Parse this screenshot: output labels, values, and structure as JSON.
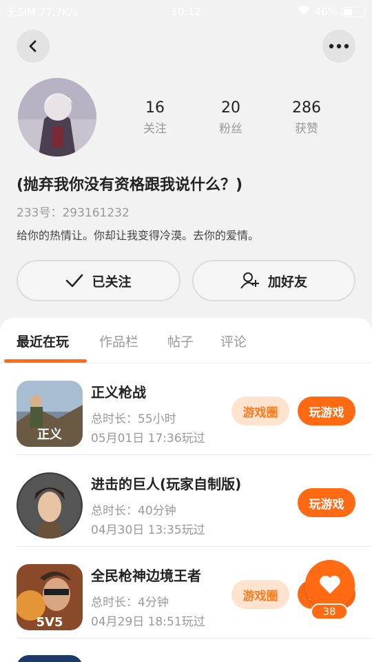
{
  "status_bar": {
    "carrier": "无SIM 77.7K/s",
    "time": "10:12",
    "battery": "46%"
  },
  "profile": {
    "following_count": "16",
    "following_label": "关注",
    "fans_count": "20",
    "fans_label": "粉丝",
    "likes_count": "286",
    "likes_label": "获赞",
    "nickname": "(抛弃我你没有资格跟我说什么？)",
    "uid_label": "233号：",
    "uid_value": "293161232",
    "bio": "给你的热情让。你却让我变得冷漠。去你的爱情。"
  },
  "actions": {
    "followed_label": "已关注",
    "add_friend_label": "加好友"
  },
  "tabs": [
    "最近在玩",
    "作品栏",
    "帖子",
    "评论"
  ],
  "games": [
    {
      "title": "正义枪战",
      "duration": "总时长：55小时",
      "last_played": "05月01日 17:36玩过",
      "circle_label": "游戏圈",
      "play_label": "玩游戏"
    },
    {
      "title": "进击的巨人(玩家自制版)",
      "duration": "总时长：40分钟",
      "last_played": "04月30日 13:35玩过",
      "play_label": "玩游戏"
    },
    {
      "title": "全民枪神边境王者",
      "duration": "总时长：4分钟",
      "last_played": "04月29日 18:51玩过",
      "circle_label": "游戏圈",
      "play_label": "玩游戏"
    }
  ],
  "fab": {
    "count": "38",
    "icon": "heart-icon"
  },
  "colors": {
    "accent": "#ff6a13",
    "accent_light": "#ffe3cf"
  }
}
